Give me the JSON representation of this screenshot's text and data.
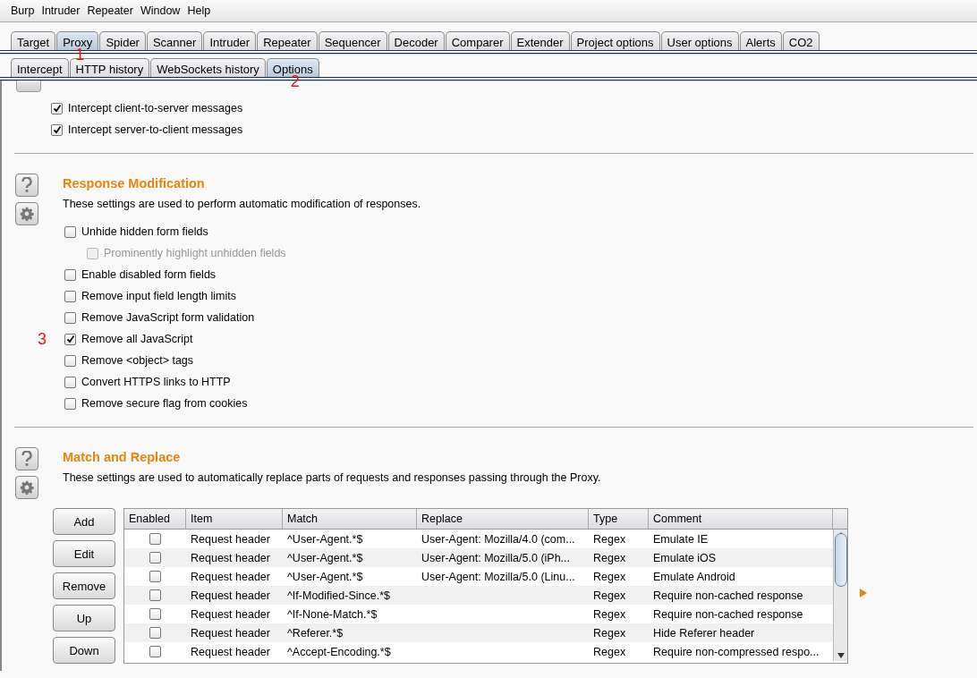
{
  "menu": [
    "Burp",
    "Intruder",
    "Repeater",
    "Window",
    "Help"
  ],
  "tabs": [
    {
      "label": "Target",
      "selected": false
    },
    {
      "label": "Proxy",
      "selected": true,
      "annotation": "1"
    },
    {
      "label": "Spider",
      "selected": false
    },
    {
      "label": "Scanner",
      "selected": false
    },
    {
      "label": "Intruder",
      "selected": false
    },
    {
      "label": "Repeater",
      "selected": false
    },
    {
      "label": "Sequencer",
      "selected": false
    },
    {
      "label": "Decoder",
      "selected": false
    },
    {
      "label": "Comparer",
      "selected": false
    },
    {
      "label": "Extender",
      "selected": false
    },
    {
      "label": "Project options",
      "selected": false
    },
    {
      "label": "User options",
      "selected": false
    },
    {
      "label": "Alerts",
      "selected": false
    },
    {
      "label": "CO2",
      "selected": false
    }
  ],
  "subtabs": [
    {
      "label": "Intercept",
      "selected": false
    },
    {
      "label": "HTTP history",
      "selected": false
    },
    {
      "label": "WebSockets history",
      "selected": false
    },
    {
      "label": "Options",
      "selected": true,
      "annotation": "2"
    }
  ],
  "intercept_options": [
    {
      "label": "Intercept client-to-server messages",
      "checked": true,
      "disabled": false
    },
    {
      "label": "Intercept server-to-client messages",
      "checked": true,
      "disabled": false
    }
  ],
  "response_modification": {
    "title": "Response Modification",
    "description": "These settings are used to perform automatic modification of responses.",
    "options": [
      {
        "label": "Unhide hidden form fields",
        "checked": false,
        "disabled": false,
        "children": [
          {
            "label": "Prominently highlight unhidden fields",
            "checked": false,
            "disabled": true
          }
        ]
      },
      {
        "label": "Enable disabled form fields",
        "checked": false,
        "disabled": false
      },
      {
        "label": "Remove input field length limits",
        "checked": false,
        "disabled": false
      },
      {
        "label": "Remove JavaScript form validation",
        "checked": false,
        "disabled": false
      },
      {
        "label": "Remove all JavaScript",
        "checked": true,
        "disabled": false,
        "annotation": "3"
      },
      {
        "label": "Remove <object> tags",
        "checked": false,
        "disabled": false
      },
      {
        "label": "Convert HTTPS links to HTTP",
        "checked": false,
        "disabled": false
      },
      {
        "label": "Remove secure flag from cookies",
        "checked": false,
        "disabled": false
      }
    ]
  },
  "match_and_replace": {
    "title": "Match and Replace",
    "description": "These settings are used to automatically replace parts of requests and responses passing through the Proxy.",
    "buttons": [
      "Add",
      "Edit",
      "Remove",
      "Up",
      "Down"
    ],
    "table": {
      "columns": [
        "Enabled",
        "Item",
        "Match",
        "Replace",
        "Type",
        "Comment"
      ],
      "rows": [
        {
          "enabled": false,
          "item": "Request header",
          "match": "^User-Agent.*$",
          "replace": "User-Agent: Mozilla/4.0 (com...",
          "type": "Regex",
          "comment": "Emulate IE"
        },
        {
          "enabled": false,
          "item": "Request header",
          "match": "^User-Agent.*$",
          "replace": "User-Agent: Mozilla/5.0 (iPh...",
          "type": "Regex",
          "comment": "Emulate iOS"
        },
        {
          "enabled": false,
          "item": "Request header",
          "match": "^User-Agent.*$",
          "replace": "User-Agent: Mozilla/5.0 (Linu...",
          "type": "Regex",
          "comment": "Emulate Android"
        },
        {
          "enabled": false,
          "item": "Request header",
          "match": "^If-Modified-Since.*$",
          "type": "Regex",
          "comment": "Require non-cached response"
        },
        {
          "enabled": false,
          "item": "Request header",
          "match": "^If-None-Match.*$",
          "type": "Regex",
          "comment": "Require non-cached response"
        },
        {
          "enabled": false,
          "item": "Request header",
          "match": "^Referer.*$",
          "type": "Regex",
          "comment": "Hide Referer header"
        },
        {
          "enabled": false,
          "item": "Request header",
          "match": "^Accept-Encoding.*$",
          "type": "Regex",
          "comment": "Require non-compressed respo..."
        }
      ]
    }
  }
}
